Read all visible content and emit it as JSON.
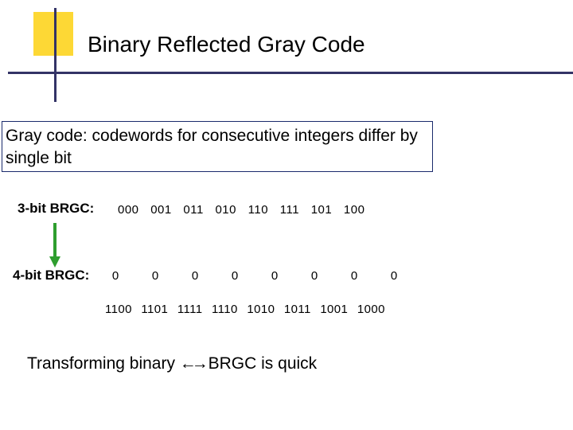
{
  "title": "Binary Reflected Gray Code",
  "definition": "Gray code: codewords for consecutive integers differ by single bit",
  "row3": {
    "label": "3-bit BRGC:",
    "codes": "000   001   011   010   110   111   101   100"
  },
  "row4": {
    "label": "4-bit BRGC:",
    "placeholders": [
      "0",
      "0",
      "0",
      "0",
      "0",
      "0",
      "0",
      "0"
    ],
    "codes": "1100   1101  1111  1110  1010  1011  1001  1000"
  },
  "transform": "Transforming binary ↔ BRGC is quick",
  "arrow_bidir": "←→"
}
